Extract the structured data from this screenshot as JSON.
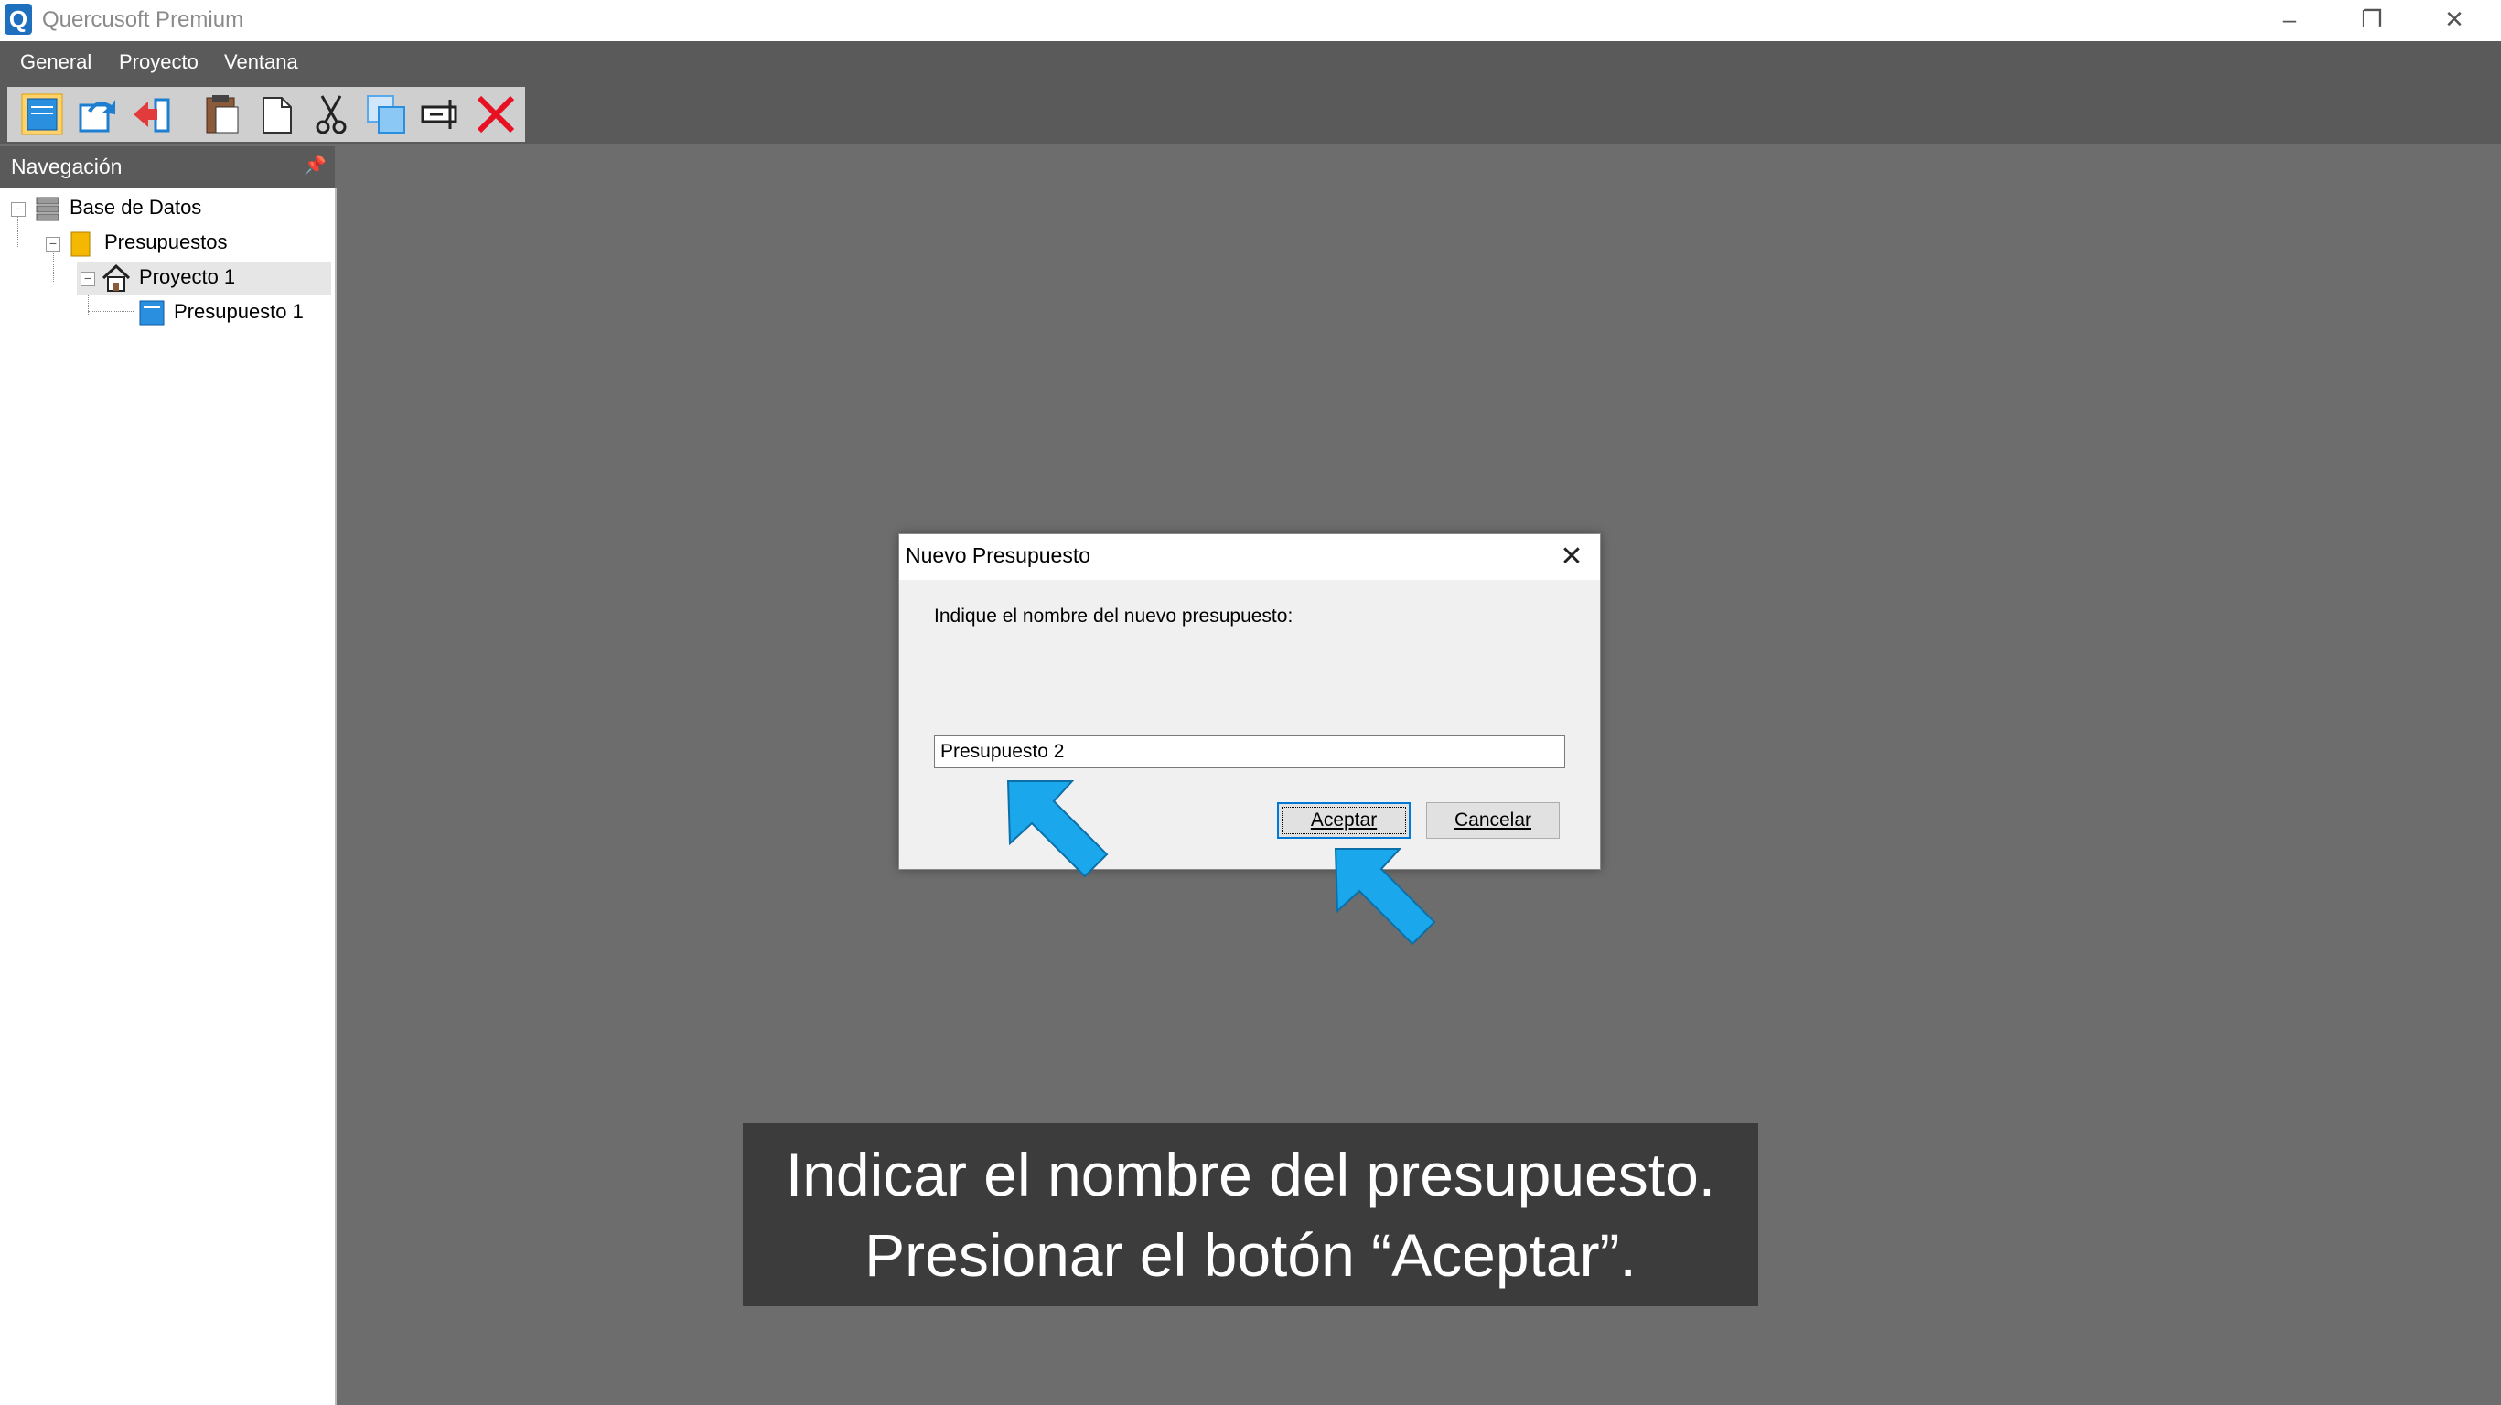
{
  "window": {
    "title": "Quercusoft Premium",
    "app_icon_letter": "Q"
  },
  "menu": {
    "items": [
      "General",
      "Proyecto",
      "Ventana"
    ]
  },
  "toolbar": {
    "icons": [
      "new-budget-icon",
      "undo-icon",
      "import-icon",
      "paste-icon",
      "copy-page-icon",
      "cut-icon",
      "duplicate-icon",
      "rename-icon",
      "delete-icon"
    ]
  },
  "navigation": {
    "title": "Navegación",
    "tree": {
      "database": "Base de Datos",
      "budgets": "Presupuestos",
      "project": "Proyecto 1",
      "budget": "Presupuesto 1"
    }
  },
  "dialog": {
    "title": "Nuevo Presupuesto",
    "prompt": "Indique el nombre del nuevo presupuesto:",
    "input_value": "Presupuesto 2",
    "accept_label": "Aceptar",
    "cancel_label": "Cancelar"
  },
  "caption": {
    "line1": "Indicar el nombre del presupuesto.",
    "line2": "Presionar el botón “Aceptar”."
  },
  "colors": {
    "accent": "#0078d7",
    "arrow": "#1aa7ec",
    "delete": "#e81123"
  }
}
